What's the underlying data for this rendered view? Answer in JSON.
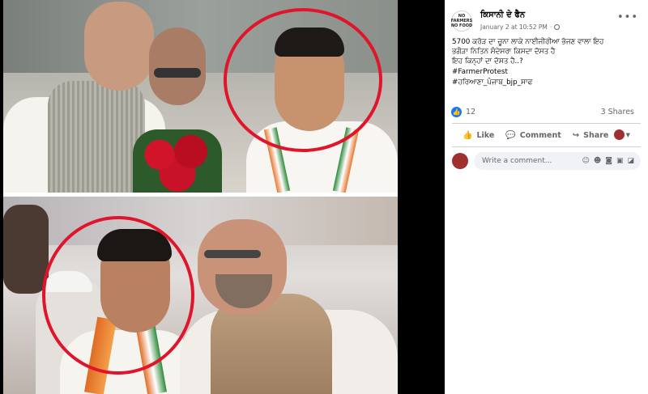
{
  "post": {
    "author": "ਕਿਸਾਨੀ ਦੇ ਫੈਨ",
    "page_logo_text": "NO FARMERS NO FOOD",
    "date": "January 2 at 10:52 PM",
    "separator": "·",
    "audience_icon": "globe-icon",
    "more_icon": "ellipsis-icon",
    "more_label": "•••",
    "text_lines": [
      "5700 ਕਰੋੜ ਦਾ ਚੂਨਾ ਲਾਕੇ ਨਾਈਜੀਰੀਆ ਭੱਜਣ ਵਾਲਾ ਇਹ",
      "ਭਗੌੜਾ ਨਿਤਿਨ ਸੰਦੇਸਰਾ ਕਿਸਦਾ ਦੋਸਤ ਹੈ",
      "ਇਹ ਕਿਨ੍ਹਾਂ ਦਾ ਦੋਸਤ ਹੈ..?"
    ],
    "hashtags": [
      "#FarmerProtest",
      "#ਹਰਿਆਣਾ_ਪੰਜਾਬ_bjp_ਸਾਫ"
    ],
    "reaction_count": "12",
    "shares": "3 Shares",
    "actions": {
      "like": "Like",
      "comment": "Comment",
      "share": "Share"
    },
    "comment_placeholder": "Write a comment..."
  },
  "colors": {
    "highlight_circle": "#e0152b",
    "facebook_blue": "#1877f2",
    "secondary_text": "#65676b"
  }
}
